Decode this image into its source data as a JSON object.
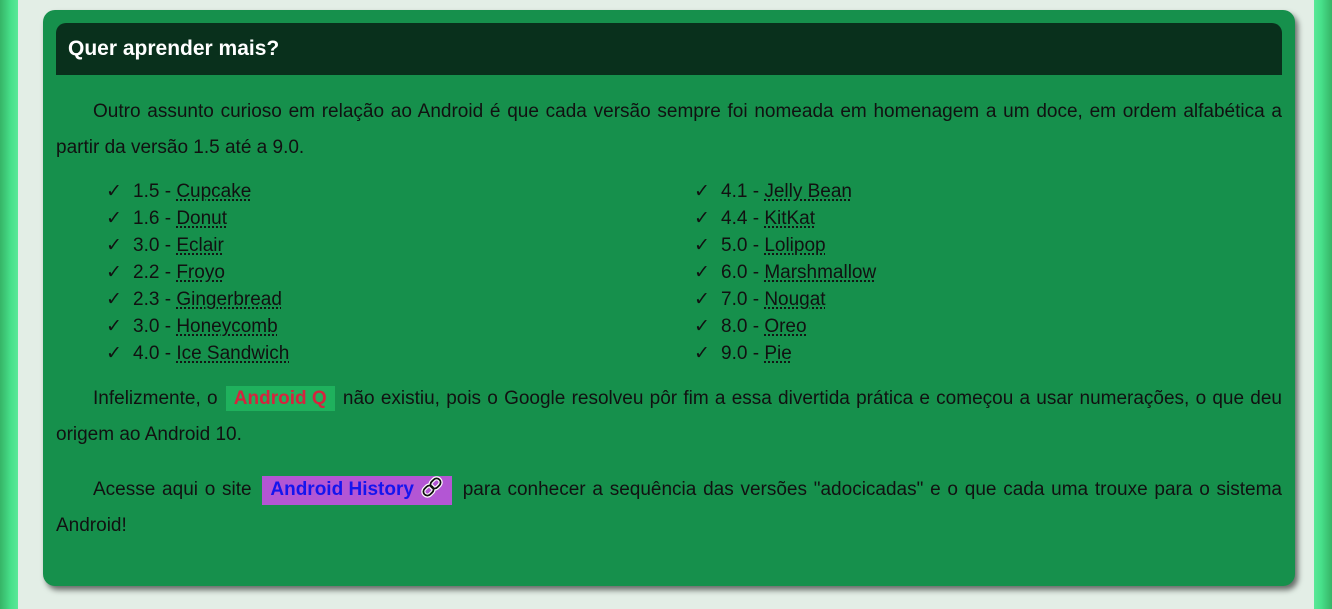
{
  "card": {
    "title": "Quer aprender mais?",
    "intro": "Outro assunto curioso em relação ao Android é que cada versão sempre foi nomeada em homenagem a um doce, em ordem alfabética a partir da versão 1.5 até a 9.0.",
    "check_glyph": "✓",
    "versions_left": [
      {
        "num": "1.5 - ",
        "name": "Cupcake"
      },
      {
        "num": "1.6 - ",
        "name": "Donut"
      },
      {
        "num": "3.0 - ",
        "name": "Eclair"
      },
      {
        "num": "2.2 - ",
        "name": "Froyo"
      },
      {
        "num": "2.3 - ",
        "name": "Gingerbread"
      },
      {
        "num": "3.0 - ",
        "name": "Honeycomb"
      },
      {
        "num": "4.0 - ",
        "name": "Ice Sandwich"
      }
    ],
    "versions_right": [
      {
        "num": "4.1 - ",
        "name": "Jelly Bean"
      },
      {
        "num": "4.4 - ",
        "name": "KitKat"
      },
      {
        "num": "5.0 - ",
        "name": "Lolipop"
      },
      {
        "num": "6.0 - ",
        "name": "Marshmallow"
      },
      {
        "num": "7.0 - ",
        "name": "Nougat"
      },
      {
        "num": "8.0 - ",
        "name": "Oreo"
      },
      {
        "num": "9.0 - ",
        "name": "Pie"
      }
    ],
    "para2_before": "Infelizmente, o ",
    "android_q": "Android Q",
    "para2_after": " não existiu, pois o Google resolveu pôr fim a essa divertida prática e começou a usar numerações, o que deu origem ao Android 10.",
    "para3_before": "Acesse aqui o site ",
    "link_label": "Android History",
    "link_icon": "link-chain-icon",
    "para3_after": " para conhecer a sequência das versões \"adocicadas\" e o que cada uma trouxe para o sistema Android!"
  },
  "colors": {
    "card_bg": "#16904c",
    "header_bg": "#09301c",
    "badge_q_bg": "#1fb15d",
    "badge_q_text": "#d5243e",
    "link_bg": "#b356d4",
    "link_text": "#1515ee"
  }
}
